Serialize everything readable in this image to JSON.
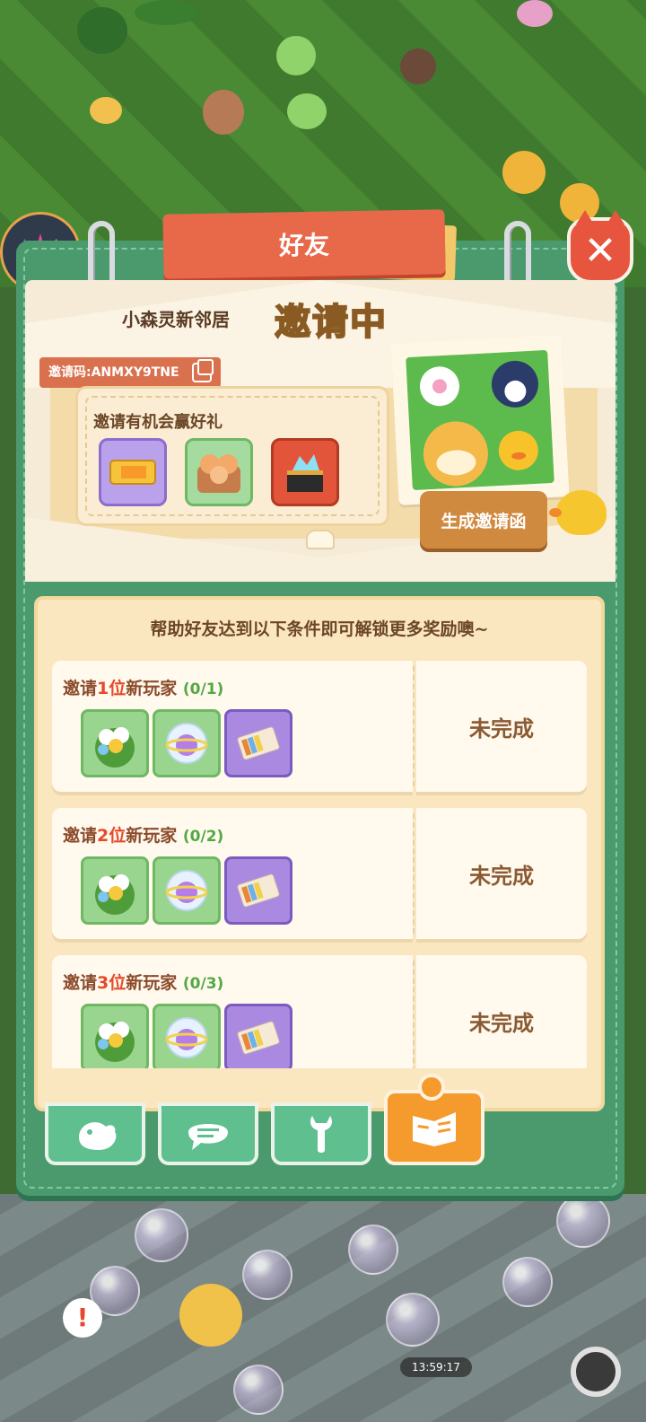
{
  "window": {
    "title": "好友"
  },
  "header": {
    "subtitle": "小森灵新邻居",
    "status_word": "邀请中",
    "invite_code_label": "邀请码:ANMXY9TNE"
  },
  "invite_panel": {
    "gift_label": "邀请有机会赢好礼",
    "gifts": [
      "ticket-icon",
      "cat-plush-icon",
      "gem-chest-icon"
    ],
    "generate_button": "生成邀请函"
  },
  "rewards": {
    "header_text": "帮助好友达到以下条件即可解锁更多奖励噢~",
    "tasks": [
      {
        "prefix": "邀请",
        "num": "1位",
        "suffix": "新玩家",
        "progress": "(0/1)",
        "status": "未完成"
      },
      {
        "prefix": "邀请",
        "num": "2位",
        "suffix": "新玩家",
        "progress": "(0/2)",
        "status": "未完成"
      },
      {
        "prefix": "邀请",
        "num": "3位",
        "suffix": "新玩家",
        "progress": "(0/3)",
        "status": "未完成"
      }
    ],
    "reward_items": [
      "flower-bush-icon",
      "planet-ball-icon",
      "ckt-ticket-icon"
    ]
  },
  "tabs": [
    {
      "name": "bird-tab-icon",
      "active": false
    },
    {
      "name": "chat-tab-icon",
      "active": false
    },
    {
      "name": "wrench-tab-icon",
      "active": false
    },
    {
      "name": "book-tab-icon",
      "active": true
    }
  ],
  "overlay": {
    "timer": "13:59:17"
  },
  "colors": {
    "panel": "#4a9a6e",
    "title_tab": "#e8694a",
    "accent_orange": "#f59a2c",
    "progress_green": "#53a843",
    "number_red": "#e64a2a"
  }
}
